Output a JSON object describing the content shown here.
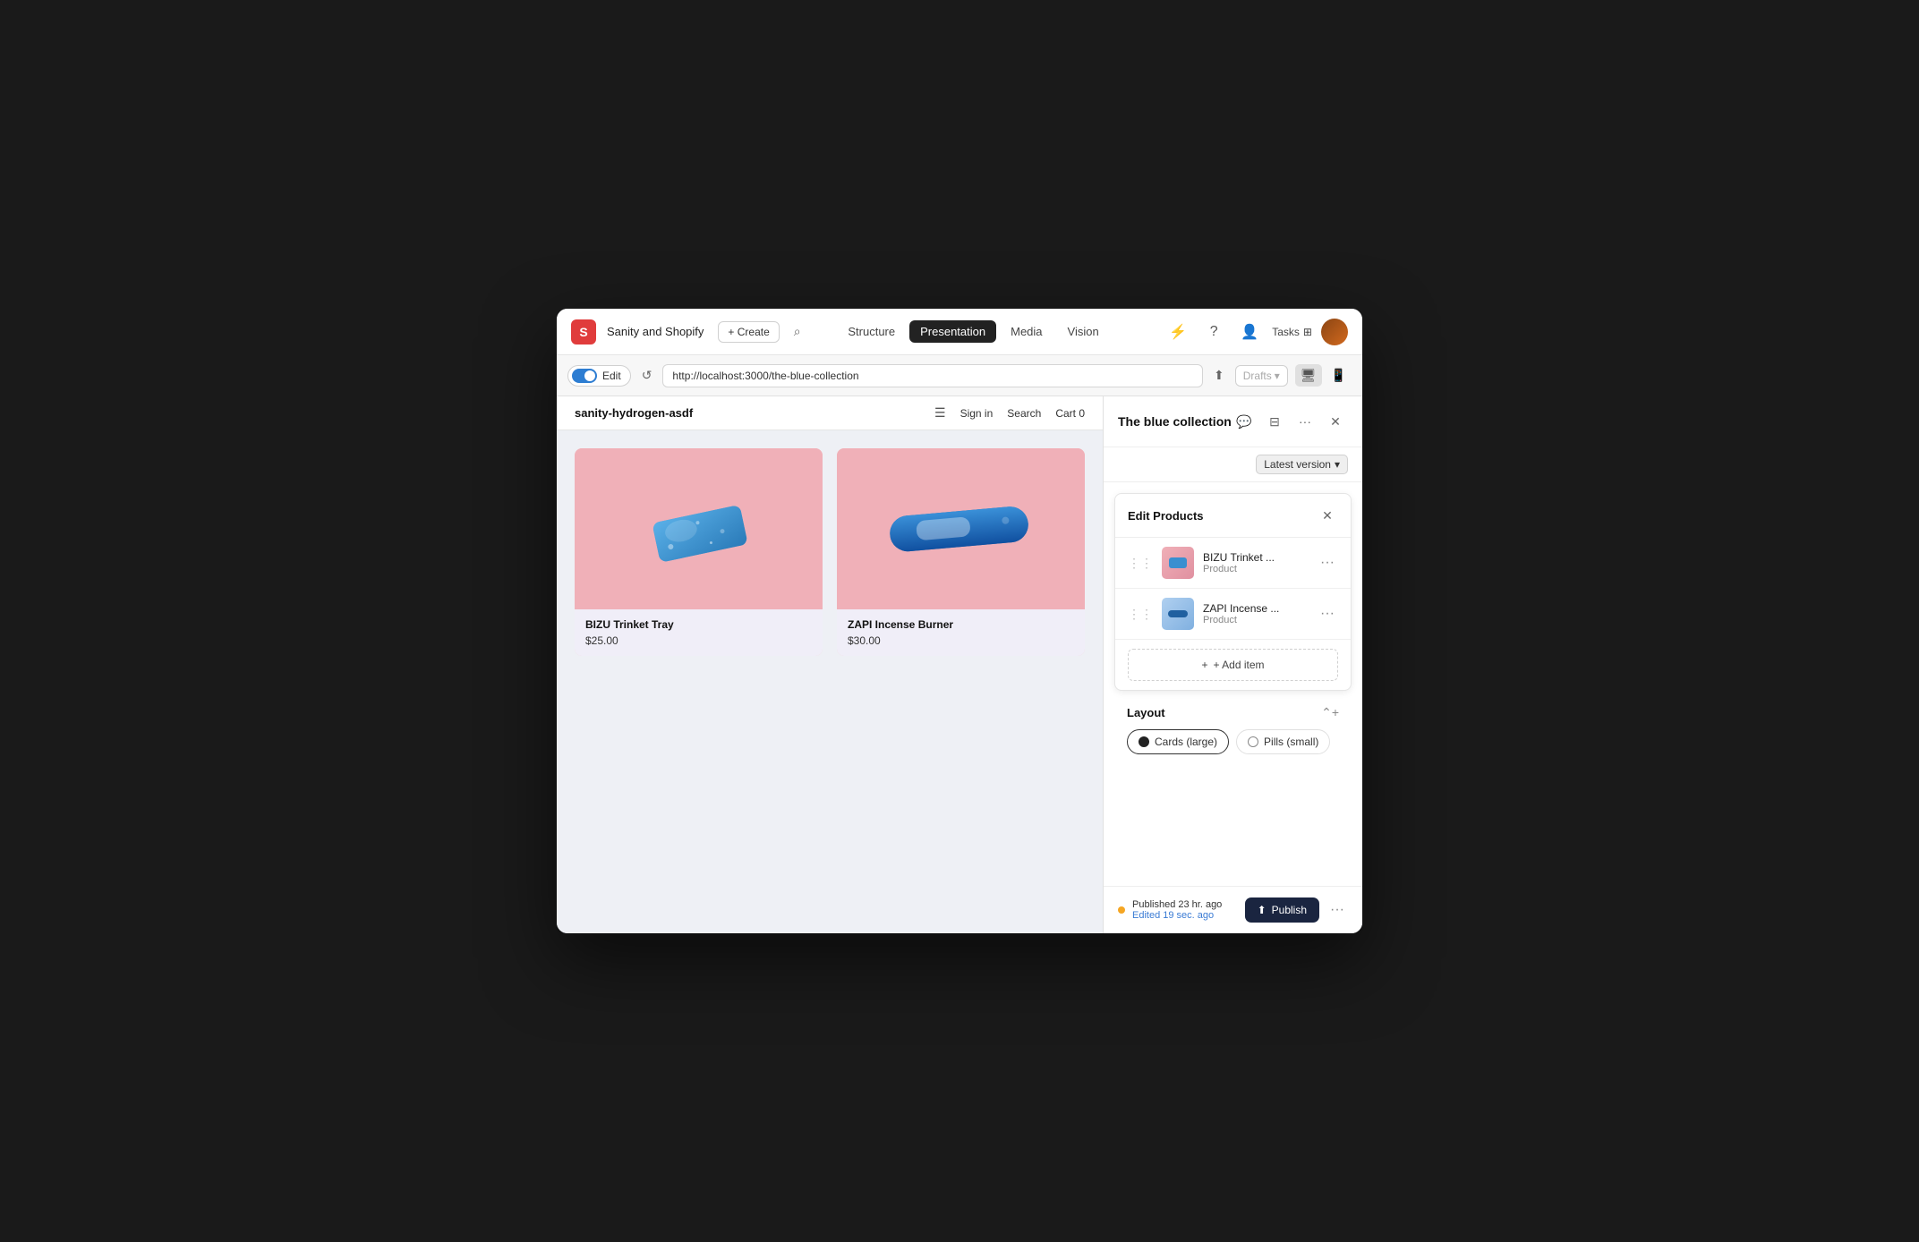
{
  "window": {
    "title": "Sanity and Shopify"
  },
  "topbar": {
    "logo_letter": "S",
    "app_name": "Sanity and Shopify",
    "create_label": "+ Create",
    "nav_items": [
      {
        "id": "structure",
        "label": "Structure",
        "active": false
      },
      {
        "id": "presentation",
        "label": "Presentation",
        "active": true
      },
      {
        "id": "media",
        "label": "Media",
        "active": false
      },
      {
        "id": "vision",
        "label": "Vision",
        "active": false
      }
    ],
    "tasks_label": "Tasks"
  },
  "browserbar": {
    "edit_label": "Edit",
    "url": "http://localhost:3000/the-blue-collection",
    "drafts_label": "Drafts"
  },
  "preview": {
    "site_name": "sanity-hydrogen-asdf",
    "nav_items": [
      {
        "label": "Sign in"
      },
      {
        "label": "Search"
      },
      {
        "label": "Cart 0"
      }
    ],
    "products": [
      {
        "id": "bizu",
        "name": "BIZU Trinket Tray",
        "price": "$25.00",
        "type": "trinket"
      },
      {
        "id": "zapi",
        "name": "ZAPI Incense Burner",
        "price": "$30.00",
        "type": "burner"
      }
    ]
  },
  "right_panel": {
    "title": "The blue collection",
    "version_label": "Latest version",
    "edit_products_title": "Edit Products",
    "product_items": [
      {
        "id": "bizu",
        "name": "BIZU Trinket ...",
        "type": "Product"
      },
      {
        "id": "zapi",
        "name": "ZAPI Incense ...",
        "type": "Product"
      }
    ],
    "add_item_label": "+ Add item",
    "layout": {
      "title": "Layout",
      "options": [
        {
          "id": "cards-large",
          "label": "Cards (large)",
          "selected": true
        },
        {
          "id": "pills-small",
          "label": "Pills (small)",
          "selected": false
        }
      ]
    },
    "footer": {
      "published_text": "Published 23 hr. ago",
      "edited_text": "Edited 19 sec. ago",
      "publish_label": "Publish"
    }
  }
}
